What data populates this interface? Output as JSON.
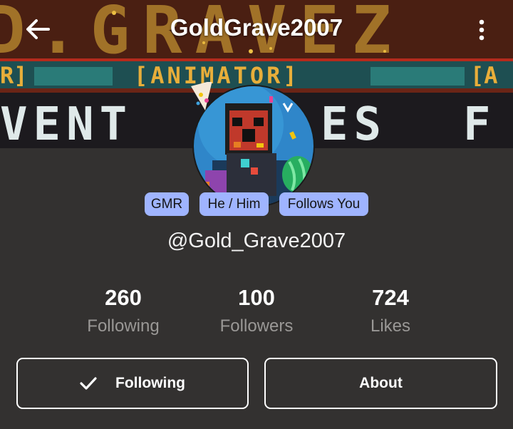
{
  "header": {
    "title": "GoldGrave2007",
    "back_icon": "arrow-left-icon",
    "menu_icon": "more-vertical-icon"
  },
  "banner": {
    "top_text": "D.GRAVEZ",
    "middle_text": "[ANIMATOR]",
    "middle_left": "R]",
    "middle_right": "[A",
    "bottom_left": "VENT",
    "bottom_mid": "ES",
    "bottom_right": "F"
  },
  "profile": {
    "badges": [
      "GMR",
      "He / Him",
      "Follows You"
    ],
    "handle": "@Gold_Grave2007"
  },
  "stats": [
    {
      "value": "260",
      "label": "Following"
    },
    {
      "value": "100",
      "label": "Followers"
    },
    {
      "value": "724",
      "label": "Likes"
    }
  ],
  "actions": {
    "following_label": "Following",
    "following_icon": "checkmark-icon",
    "about_label": "About"
  },
  "colors": {
    "background": "#333130",
    "badge": "#9fb4ff",
    "banner_accent": "#e8b63a"
  }
}
